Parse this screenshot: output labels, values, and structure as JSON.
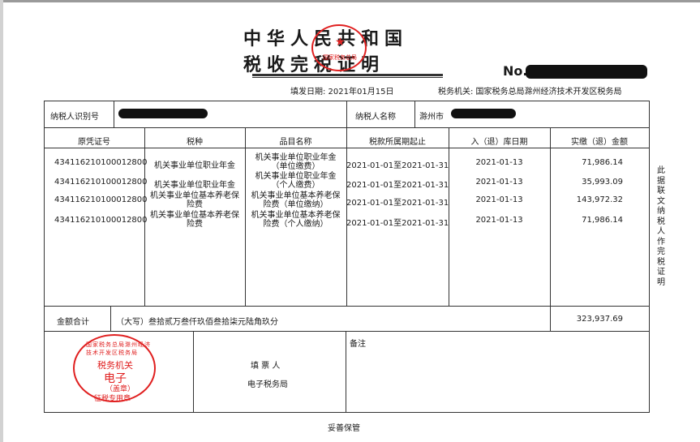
{
  "header": {
    "title_line1": "中华人民共和国",
    "title_line2": "税收完税证明",
    "no_label": "No.",
    "fill_date": "填发日期: 2021年01月15日",
    "tax_authority": "税务机关: 国家税务总局滁州经济技术开发区税务局",
    "seal_ring_text": "国家税务总局"
  },
  "taxpayer": {
    "id_label": "纳税人识别号",
    "name_label": "纳税人名称",
    "name_prefix": "滁州市"
  },
  "table": {
    "headers": [
      "原凭证号",
      "税种",
      "品目名称",
      "税款所属期起止",
      "入（退）库日期",
      "实缴（退）金额"
    ],
    "rows": [
      {
        "voucher": "434116210100012800",
        "tax_type": "机关事业单位职业年金",
        "item_name": "机关事业单位职业年金（单位缴费）",
        "period": "2021-01-01至2021-01-31",
        "date": "2021-01-13",
        "amount": "71,986.14"
      },
      {
        "voucher": "434116210100012800",
        "tax_type": "机关事业单位职业年金",
        "item_name": "机关事业单位职业年金（个人缴费）",
        "period": "2021-01-01至2021-01-31",
        "date": "2021-01-13",
        "amount": "35,993.09"
      },
      {
        "voucher": "434116210100012800",
        "tax_type": "机关事业单位基本养老保险费",
        "item_name": "机关事业单位基本养老保险费（单位缴纳）",
        "period": "2021-01-01至2021-01-31",
        "date": "2021-01-13",
        "amount": "143,972.32"
      },
      {
        "voucher": "434116210100012800",
        "tax_type": "机关事业单位基本养老保险费",
        "item_name": "机关事业单位基本养老保险费（个人缴纳）",
        "period": "2021-01-01至2021-01-31",
        "date": "2021-01-13",
        "amount": "71,986.14"
      }
    ],
    "total_label": "金额合计",
    "total_words": "（大写）叁拾贰万叁仟玖佰叁拾柒元陆角玖分",
    "total_amount": "323,937.69"
  },
  "footer": {
    "filler_label": "填  票  人",
    "filler_value": "电子税务局",
    "remarks_label": "备注",
    "keep_safe": "妥善保管",
    "seal_line1": "税务机关",
    "seal_line2": "电子",
    "seal_line3": "（盖章）",
    "seal_line4": "征税专用章",
    "seal_ring": "国家税务总局滁州经济技术开发区税务局"
  },
  "side_note": "此据联文纳税人作完税证明",
  "colors": {
    "seal_red": "#e02020",
    "line": "#333333",
    "redaction": "#111111"
  }
}
